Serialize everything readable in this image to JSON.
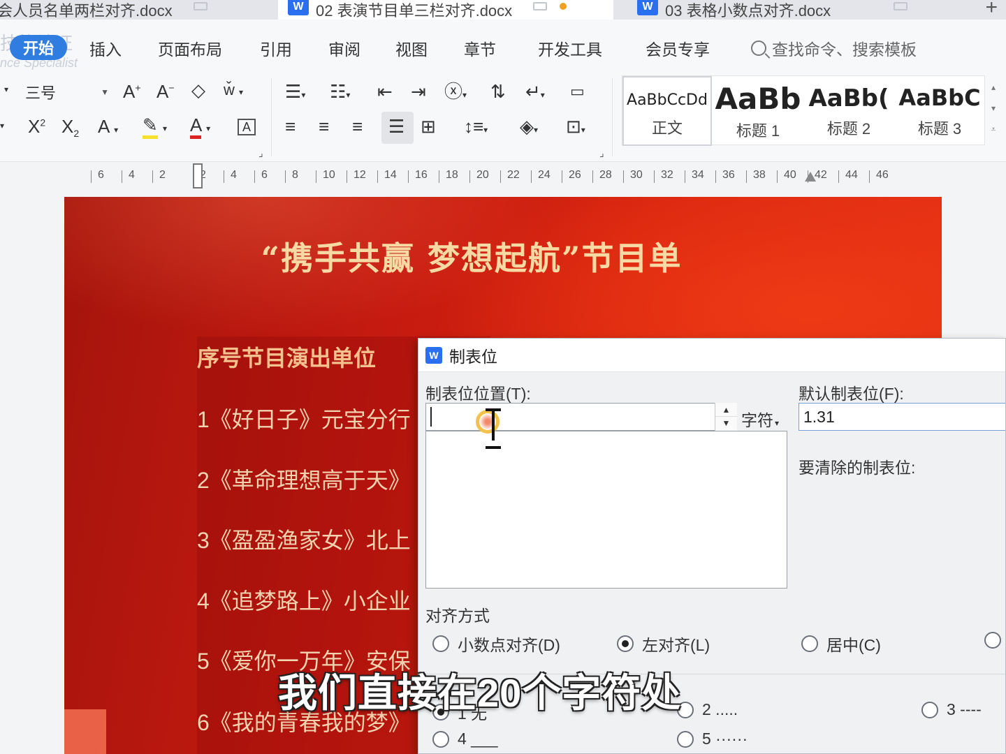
{
  "tabs": [
    {
      "label": "会人员名单两栏对齐.docx",
      "active": false
    },
    {
      "label": "02 表演节目单三栏对齐.docx",
      "active": true
    },
    {
      "label": "03 表格小数点对齐.docx",
      "active": false
    }
  ],
  "app_icon_letter": "W",
  "new_tab": "+",
  "menu": {
    "ghost_top": "技能认证",
    "ghost_bottom": "nce Specialist",
    "start": "开始",
    "items": [
      "插入",
      "页面布局",
      "引用",
      "审阅",
      "视图",
      "章节",
      "开发工具",
      "会员专享"
    ],
    "search": "查找命令、搜索模板"
  },
  "ribbon": {
    "font_size": "三号",
    "styles": [
      {
        "sample": "AaBbCcDd",
        "name": "正文"
      },
      {
        "sample": "AaBb",
        "name": "标题 1"
      },
      {
        "sample": "AaBb(",
        "name": "标题 2"
      },
      {
        "sample": "AaBbC",
        "name": "标题 3"
      }
    ]
  },
  "ruler": [
    "6",
    "4",
    "2",
    "2",
    "4",
    "6",
    "8",
    "10",
    "12",
    "14",
    "16",
    "18",
    "20",
    "22",
    "24",
    "26",
    "28",
    "30",
    "32",
    "34",
    "36",
    "38",
    "40",
    "42",
    "44",
    "46"
  ],
  "document": {
    "title": "“携手共赢  梦想起航”节目单",
    "header": "序号节目演出单位",
    "programs": [
      "1《好日子》元宝分行",
      "2《革命理想高于天》",
      "3《盈盈渔家女》北上",
      "4《追梦路上》小企业",
      "5《爱你一万年》安保",
      "6《我的青春我的梦》"
    ]
  },
  "dialog": {
    "title": "制表位",
    "position_label": "制表位位置(T):",
    "position_value": "",
    "unit": "字符",
    "default_label": "默认制表位(F):",
    "default_value": "1.31",
    "clear_label": "要清除的制表位:",
    "align_label": "对齐方式",
    "align_options": [
      {
        "label": "小数点对齐(D)",
        "checked": false
      },
      {
        "label": "左对齐(L)",
        "checked": true
      },
      {
        "label": "居中(C)",
        "checked": false
      }
    ],
    "leader_options": [
      {
        "label": "1 无",
        "checked": true
      },
      {
        "label": "2 .....",
        "checked": false
      },
      {
        "label": "3 ----",
        "checked": false
      },
      {
        "label": "4 ___",
        "checked": false
      },
      {
        "label": "5 ······",
        "checked": false
      }
    ]
  },
  "subtitle": "我们直接在20个字符处"
}
